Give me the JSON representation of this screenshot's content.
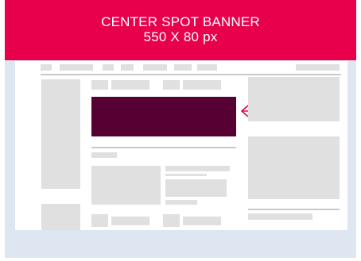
{
  "banner": {
    "line1": "CENTER SPOT BANNER",
    "line2": "550 X 80 px"
  },
  "colors": {
    "banner_background": "#e8004d",
    "spot_highlight": "#560033",
    "arrow": "#e8004d",
    "outer_background": "#dde6f1",
    "placeholder_block": "#e0e0e0"
  },
  "icons": {
    "pointer": "left-arrow-icon"
  }
}
